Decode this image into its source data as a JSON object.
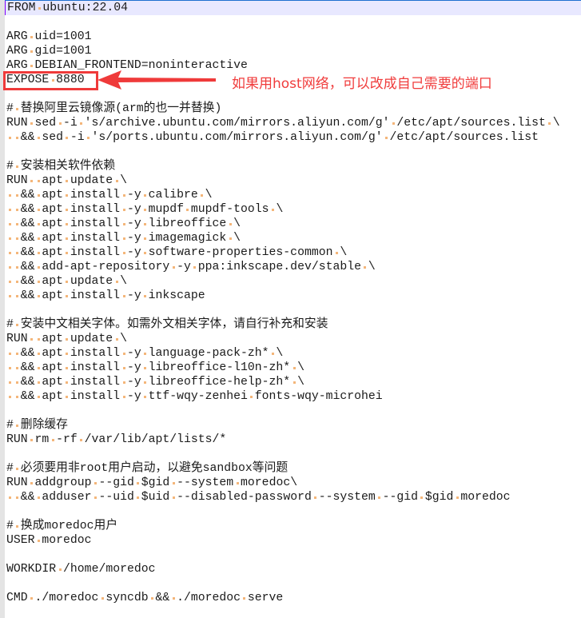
{
  "editor": {
    "current_line": 0,
    "lines": [
      "FROM ubuntu:22.04",
      "",
      "ARG uid=1001",
      "ARG gid=1001",
      "ARG DEBIAN_FRONTEND=noninteractive",
      "EXPOSE 8880",
      "",
      "# 替换阿里云镜像源(arm的也一并替换)",
      "RUN sed -i 's/archive.ubuntu.com/mirrors.aliyun.com/g' /etc/apt/sources.list \\",
      "  && sed -i 's/ports.ubuntu.com/mirrors.aliyun.com/g' /etc/apt/sources.list",
      "",
      "# 安装相关软件依赖",
      "RUN  apt update \\",
      "  && apt install -y calibre \\",
      "  && apt install -y mupdf mupdf-tools \\",
      "  && apt install -y libreoffice \\",
      "  && apt install -y imagemagick \\",
      "  && apt install -y software-properties-common \\",
      "  && add-apt-repository -y ppa:inkscape.dev/stable \\",
      "  && apt update \\",
      "  && apt install -y inkscape",
      "",
      "# 安装中文相关字体。如需外文相关字体，请自行补充和安装",
      "RUN  apt update \\",
      "  && apt install -y language-pack-zh* \\",
      "  && apt install -y libreoffice-l10n-zh* \\",
      "  && apt install -y libreoffice-help-zh* \\",
      "  && apt install -y ttf-wqy-zenhei fonts-wqy-microhei",
      "",
      "# 删除缓存",
      "RUN rm -rf /var/lib/apt/lists/*",
      "",
      "# 必须要用非root用户启动，以避免sandbox等问题",
      "RUN addgroup --gid $gid --system moredoc\\",
      "  && adduser --uid $uid --disabled-password --system --gid $gid moredoc",
      "",
      "# 换成moredoc用户",
      "USER moredoc",
      "",
      "WORKDIR /home/moredoc",
      "",
      "CMD ./moredoc syncdb && ./moredoc serve"
    ]
  },
  "annotation": {
    "text": "如果用host网络，可以改成自己需要的端口",
    "color": "#ef3a3a",
    "target_line": 5
  },
  "colors": {
    "whitespace_dot": "#f4b67a",
    "current_line_bg": "#e8e8ff",
    "gutter": "#e4e4e4"
  }
}
